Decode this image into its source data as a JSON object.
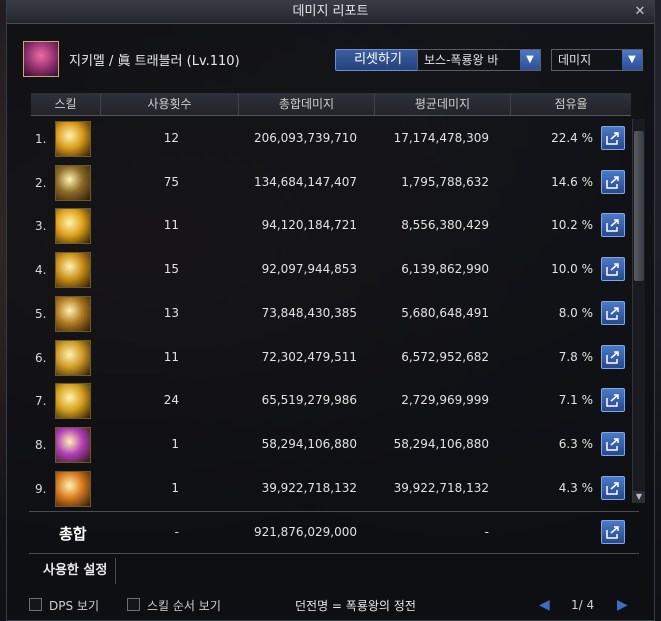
{
  "window": {
    "title": "데미지 리포트",
    "close": "✕"
  },
  "character": {
    "name": "지키멜 / 眞 트래블러 (Lv.110)"
  },
  "controls": {
    "reset_label": "리셋하기",
    "target_select": "보스-폭룡왕 바",
    "metric_select": "데미지"
  },
  "table": {
    "headers": [
      "스킬",
      "사용횟수",
      "총합데미지",
      "평균데미지",
      "점유율"
    ],
    "rows": [
      {
        "rank": "1.",
        "count": "12",
        "total": "206,093,739,710",
        "avg": "17,174,478,309",
        "share": "22.4 %",
        "icon_color": "#d89a1c"
      },
      {
        "rank": "2.",
        "count": "75",
        "total": "134,684,147,407",
        "avg": "1,795,788,632",
        "share": "14.6 %",
        "icon_color": "#8c6a2a"
      },
      {
        "rank": "3.",
        "count": "11",
        "total": "94,120,184,721",
        "avg": "8,556,380,429",
        "share": "10.2 %",
        "icon_color": "#e0a21a"
      },
      {
        "rank": "4.",
        "count": "15",
        "total": "92,097,944,853",
        "avg": "6,139,862,990",
        "share": "10.0 %",
        "icon_color": "#c98f18"
      },
      {
        "rank": "5.",
        "count": "13",
        "total": "73,848,430,385",
        "avg": "5,680,648,491",
        "share": "8.0 %",
        "icon_color": "#b07a22"
      },
      {
        "rank": "6.",
        "count": "11",
        "total": "72,302,479,511",
        "avg": "6,572,952,682",
        "share": "7.8 %",
        "icon_color": "#cf9a25"
      },
      {
        "rank": "7.",
        "count": "24",
        "total": "65,519,279,986",
        "avg": "2,729,969,999",
        "share": "7.1 %",
        "icon_color": "#d6a11e"
      },
      {
        "rank": "8.",
        "count": "1",
        "total": "58,294,106,880",
        "avg": "58,294,106,880",
        "share": "6.3 %",
        "icon_color": "#b23fb8"
      },
      {
        "rank": "9.",
        "count": "1",
        "total": "39,922,718,132",
        "avg": "39,922,718,132",
        "share": "4.3 %",
        "icon_color": "#d8781e"
      }
    ]
  },
  "totals": {
    "label": "총합",
    "count": "-",
    "total": "921,876,029,000",
    "avg": "-"
  },
  "used_tab": "사용한 설정",
  "footer": {
    "dps_label": "DPS 보기",
    "order_label": "스킬 순서 보기",
    "dungeon": "던전명 = 폭룡왕의 정전",
    "prev": "◀",
    "next": "▶",
    "page": "1/ 4"
  },
  "colors": {
    "accent": "#3f6bc2",
    "button": "#2d4f95"
  }
}
